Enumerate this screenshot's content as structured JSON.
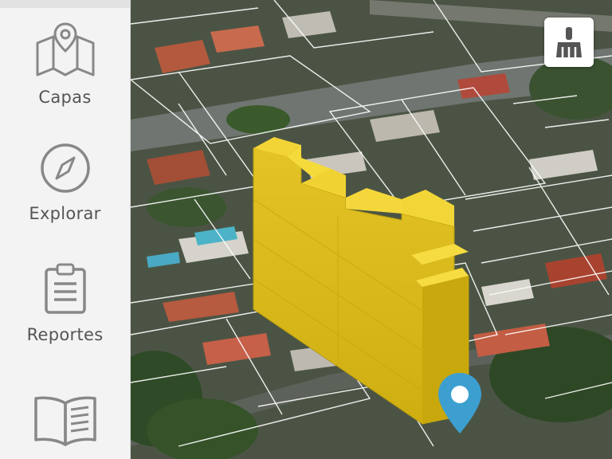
{
  "sidebar": {
    "items": [
      {
        "label": "Capas",
        "icon": "map-icon"
      },
      {
        "label": "Explorar",
        "icon": "compass-icon"
      },
      {
        "label": "Reportes",
        "icon": "clipboard-icon"
      },
      {
        "label": "",
        "icon": "book-icon"
      }
    ]
  },
  "map": {
    "view": "3D satellite",
    "selected_building_color": "#e8c21a",
    "parcel_line_color": "#ffffff",
    "pin_color": "#3c9fd0"
  },
  "toolbar": {
    "clean_icon": "broom-icon"
  }
}
